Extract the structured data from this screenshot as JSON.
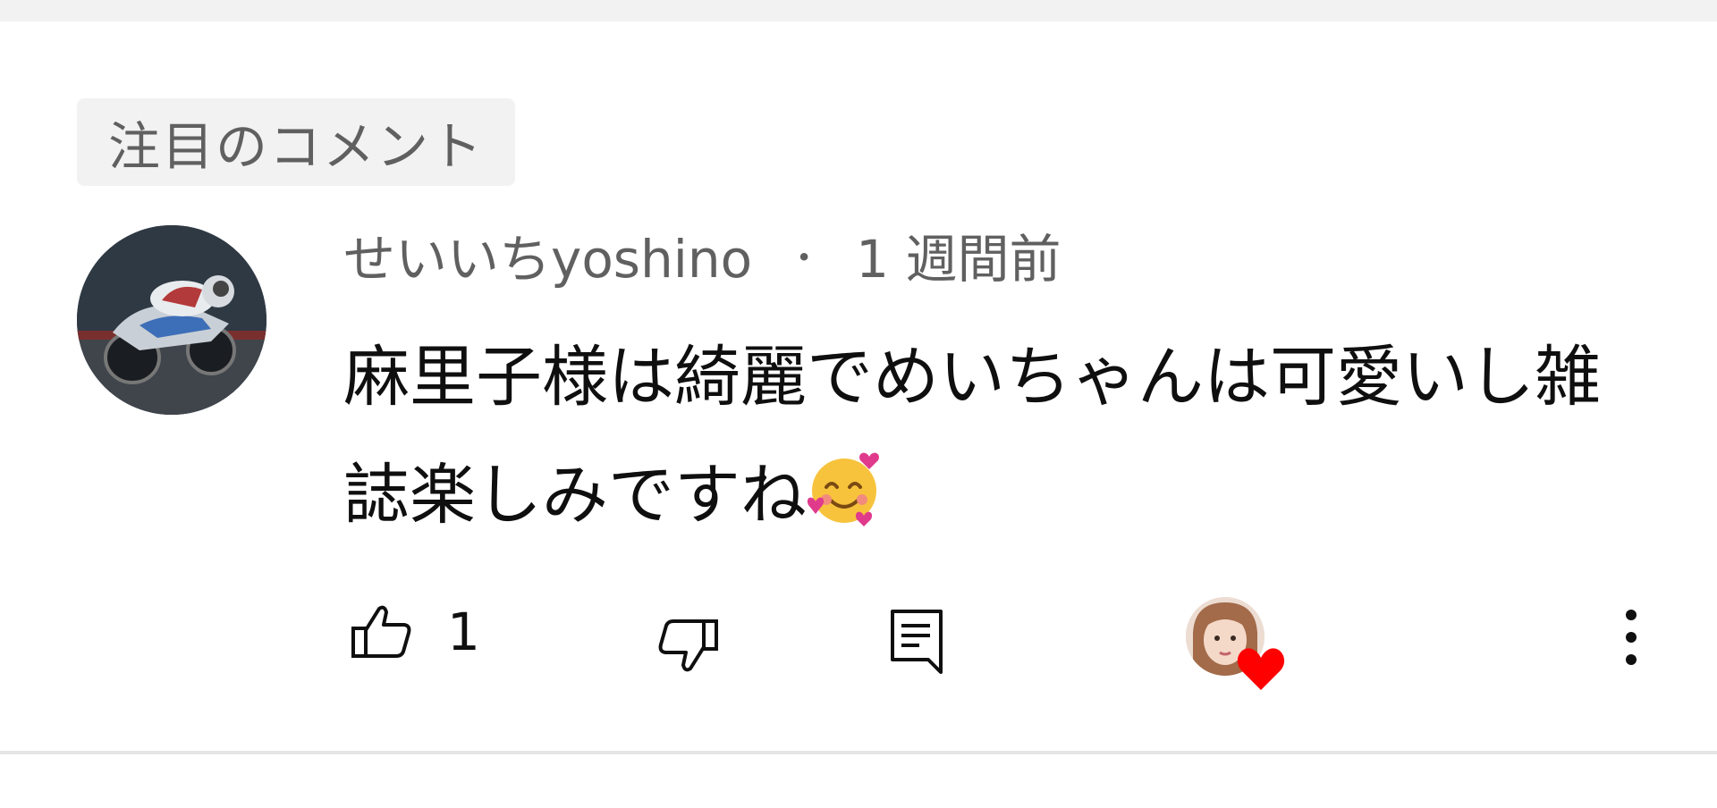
{
  "section": {
    "label": "注目のコメント"
  },
  "comment": {
    "author": "せいいちyoshino",
    "separator": "・",
    "timestamp": "1 週間前",
    "text": "麻里子様は綺麗でめいちゃんは可愛いし雑誌楽しみですね",
    "emoji": "smiling-face-with-hearts-emoji",
    "like_count": "1"
  },
  "icons": {
    "like": "thumb-up-icon",
    "dislike": "thumb-down-icon",
    "reply": "reply-comment-icon",
    "creator_heart": "creator-heart-icon",
    "more": "more-vertical-icon"
  },
  "colors": {
    "primary_text": "#0f0f0f",
    "secondary_text": "#606060",
    "chip_background": "#f2f2f2",
    "heart": "#ff0000"
  }
}
